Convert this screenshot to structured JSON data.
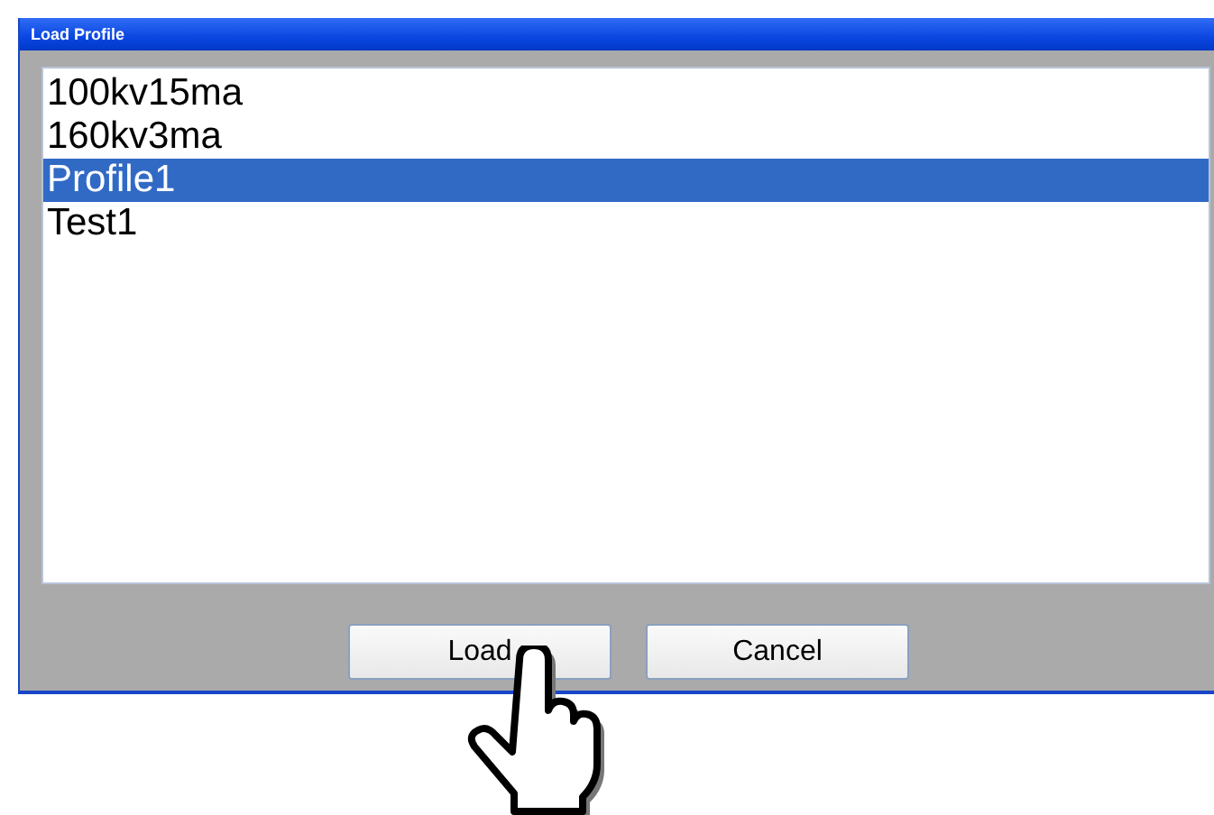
{
  "window": {
    "title": "Load Profile"
  },
  "profiles": [
    {
      "name": "100kv15ma",
      "selected": false
    },
    {
      "name": "160kv3ma",
      "selected": false
    },
    {
      "name": "Profile1",
      "selected": true
    },
    {
      "name": "Test1",
      "selected": false
    }
  ],
  "buttons": [
    "Load",
    "Cancel"
  ]
}
